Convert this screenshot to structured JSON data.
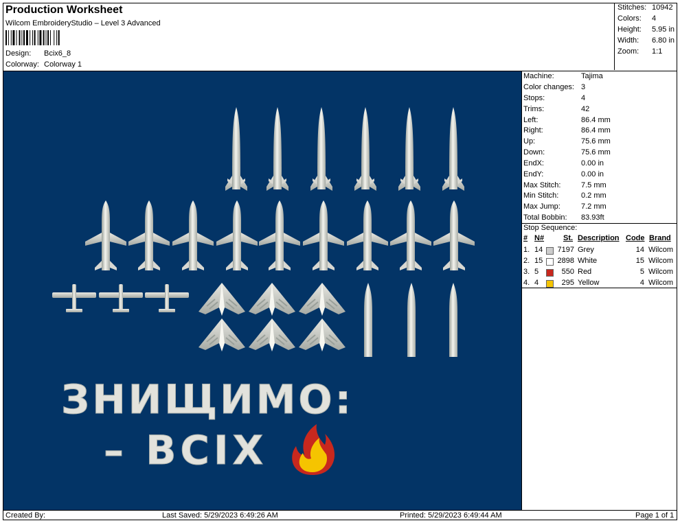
{
  "header": {
    "title": "Production Worksheet",
    "app": "Wilcom EmbroideryStudio – Level 3 Advanced",
    "design_label": "Design:",
    "design_value": "Bcix6_8",
    "colorway_label": "Colorway:",
    "colorway_value": "Colorway 1"
  },
  "stats": [
    {
      "label": "Stitches:",
      "value": "10942"
    },
    {
      "label": "Colors:",
      "value": "4"
    },
    {
      "label": "Height:",
      "value": "5.95 in"
    },
    {
      "label": "Width:",
      "value": "6.80 in"
    },
    {
      "label": "Zoom:",
      "value": "1:1"
    }
  ],
  "machine_info": [
    {
      "label": "Machine:",
      "value": "Tajima"
    },
    {
      "label": "Color changes:",
      "value": "3"
    },
    {
      "label": "Stops:",
      "value": "4"
    },
    {
      "label": "Trims:",
      "value": "42"
    },
    {
      "label": "Left:",
      "value": "86.4 mm"
    },
    {
      "label": "Right:",
      "value": "86.4 mm"
    },
    {
      "label": "Up:",
      "value": "75.6 mm"
    },
    {
      "label": "Down:",
      "value": "75.6 mm"
    },
    {
      "label": "EndX:",
      "value": "0.00 in"
    },
    {
      "label": "EndY:",
      "value": "0.00 in"
    },
    {
      "label": "Max Stitch:",
      "value": "7.5 mm"
    },
    {
      "label": "Min Stitch:",
      "value": "0.2 mm"
    },
    {
      "label": "Max Jump:",
      "value": "7.2 mm"
    },
    {
      "label": "Total Bobbin:",
      "value": "83.93ft"
    }
  ],
  "stop_sequence": {
    "title": "Stop Sequence:",
    "headers": {
      "num": "#",
      "needle": "N#",
      "stitches": "St.",
      "description": "Description",
      "code": "Code",
      "brand": "Brand"
    },
    "rows": [
      {
        "num": "1.",
        "needle": "14",
        "stitches": "7197",
        "description": "Grey",
        "code": "14",
        "brand": "Wilcom",
        "color": "#cccccc"
      },
      {
        "num": "2.",
        "needle": "15",
        "stitches": "2898",
        "description": "White",
        "code": "15",
        "brand": "Wilcom",
        "color": "#ffffff"
      },
      {
        "num": "3.",
        "needle": "5",
        "stitches": "550",
        "description": "Red",
        "code": "5",
        "brand": "Wilcom",
        "color": "#c8281e"
      },
      {
        "num": "4.",
        "needle": "4",
        "stitches": "295",
        "description": "Yellow",
        "code": "4",
        "brand": "Wilcom",
        "color": "#f5c400"
      }
    ]
  },
  "design": {
    "background": "#033466",
    "line1": "ЗНИЩИМО:",
    "line2": "– ВСІХ"
  },
  "footer": {
    "created_by": "Created By:",
    "last_saved": "Last Saved: 5/29/2023 6:49:26 AM",
    "printed": "Printed: 5/29/2023 6:49:44 AM",
    "page": "Page 1 of 1"
  }
}
